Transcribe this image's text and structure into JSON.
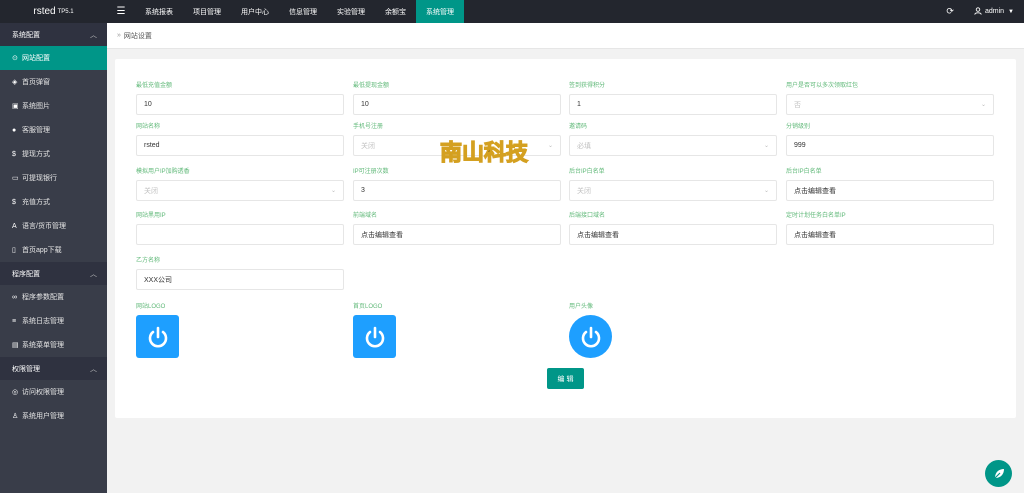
{
  "app": {
    "name": "rsted",
    "version": "TP5.1"
  },
  "topnav": {
    "menu_icon": "hamburger-icon",
    "items": [
      {
        "label": "系统报表"
      },
      {
        "label": "项目管理"
      },
      {
        "label": "用户中心"
      },
      {
        "label": "信息管理"
      },
      {
        "label": "实验管理"
      },
      {
        "label": "余额宝"
      },
      {
        "label": "系统管理",
        "active": true
      }
    ],
    "refresh_icon": "refresh-icon",
    "user": "admin"
  },
  "sidebar": {
    "groups": [
      {
        "label": "系统配置",
        "items": [
          {
            "label": "网站配置",
            "icon": "settings-icon",
            "active": true
          },
          {
            "label": "首页弹窗",
            "icon": "tag-icon"
          },
          {
            "label": "系统图片",
            "icon": "image-icon"
          },
          {
            "label": "客服管理",
            "icon": "chat-icon"
          },
          {
            "label": "提现方式",
            "icon": "dollar-icon"
          },
          {
            "label": "可提现银行",
            "icon": "card-icon"
          },
          {
            "label": "充值方式",
            "icon": "dollar-icon"
          },
          {
            "label": "语言/货币管理",
            "icon": "font-icon"
          },
          {
            "label": "首页app下载",
            "icon": "phone-icon"
          }
        ]
      },
      {
        "label": "程序配置",
        "items": [
          {
            "label": "程序参数配置",
            "icon": "link-icon"
          },
          {
            "label": "系统日志管理",
            "icon": "list-icon"
          },
          {
            "label": "系统菜单管理",
            "icon": "menu-icon"
          }
        ]
      },
      {
        "label": "权限管理",
        "items": [
          {
            "label": "访问权限管理",
            "icon": "shield-icon"
          },
          {
            "label": "系统用户管理",
            "icon": "user-icon"
          }
        ]
      }
    ]
  },
  "breadcrumb": {
    "label": "网站设置"
  },
  "form": {
    "row1": [
      {
        "label": "最低充值金额",
        "value": "10"
      },
      {
        "label": "最低提现金额",
        "value": "10"
      },
      {
        "label": "签到获得积分",
        "value": "1"
      },
      {
        "label": "用户是否可以多次领取红包",
        "placeholder": "否"
      }
    ],
    "row2": [
      {
        "label": "网站名称",
        "value": "rsted"
      },
      {
        "label": "手机号注册",
        "placeholder": "关闭"
      },
      {
        "label": "邀请码",
        "placeholder": "必填"
      },
      {
        "label": "分销级别",
        "value": "999"
      }
    ],
    "row3": [
      {
        "label": "模拟用户IP加购透香",
        "placeholder": "关闭"
      },
      {
        "label": "IP可注册次数",
        "value": "3"
      },
      {
        "label": "后台IP白名单",
        "placeholder": "关闭"
      },
      {
        "label": "后台IP白名单",
        "value": "点击编辑查看"
      }
    ],
    "row4": [
      {
        "label": "网站黑用IP",
        "value": ""
      },
      {
        "label": "前端域名",
        "value": "点击编辑查看"
      },
      {
        "label": "后端接口域名",
        "value": "点击编辑查看"
      },
      {
        "label": "定时计划任务白名单IP",
        "value": "点击编辑查看"
      }
    ],
    "row5": [
      {
        "label": "乙方名称",
        "value": "XXX公司"
      }
    ],
    "images": [
      {
        "label": "网站LOGO",
        "shape": "square"
      },
      {
        "label": "首页LOGO",
        "shape": "square"
      },
      {
        "label": "用户头像",
        "shape": "circle"
      }
    ],
    "submit_label": "编 辑"
  },
  "watermark": {
    "text": "南山科技"
  },
  "colors": {
    "accent": "#009688",
    "sidebar_bg": "#393d49",
    "topbar_bg": "#23262e",
    "label": "#5fb878",
    "logo_blue": "#1e9fff"
  },
  "float_button": {
    "icon": "leaf-icon"
  }
}
